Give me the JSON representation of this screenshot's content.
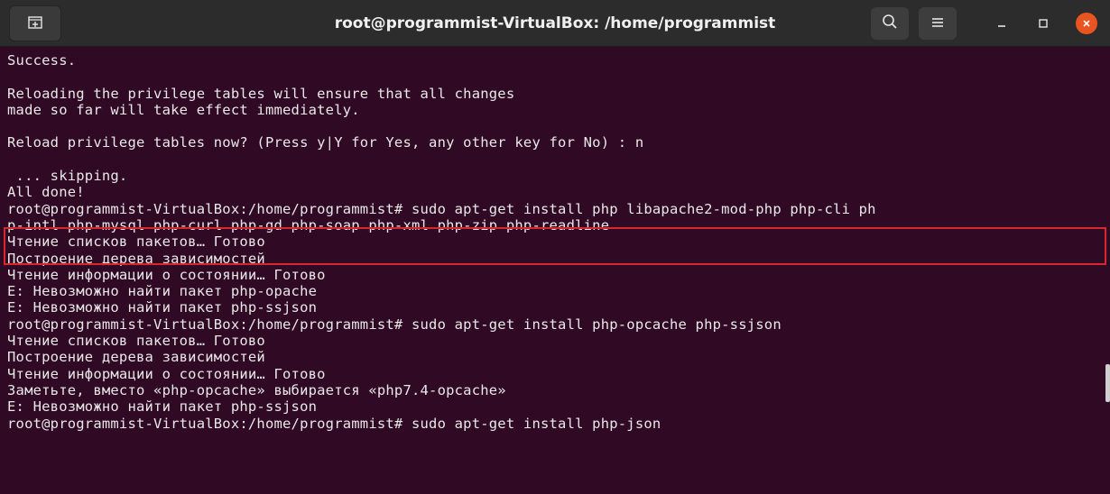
{
  "window": {
    "title": "root@programmist-VirtualBox: /home/programmist",
    "icons": {
      "new_tab": "new-tab-icon",
      "search": "search-icon",
      "menu": "hamburger-menu-icon",
      "minimize": "minimize-icon",
      "maximize": "maximize-icon",
      "close": "close-icon"
    },
    "colors": {
      "terminal_bg": "#300a24",
      "titlebar_bg": "#2c2c2c",
      "close_accent": "#e95420",
      "highlight_border": "#d7262c"
    }
  },
  "terminal": {
    "lines": [
      "Success.",
      "",
      "Reloading the privilege tables will ensure that all changes",
      "made so far will take effect immediately.",
      "",
      "Reload privilege tables now? (Press y|Y for Yes, any other key for No) : n",
      "",
      " ... skipping.",
      "All done!",
      "root@programmist-VirtualBox:/home/programmist# sudo apt-get install php libapache2-mod-php php-cli ph",
      "p-intl php-mysql php-curl php-gd php-soap php-xml php-zip php-readline",
      "Чтение списков пакетов… Готово",
      "Построение дерева зависимостей",
      "Чтение информации о состоянии… Готово",
      "E: Невозможно найти пакет php-opache",
      "E: Невозможно найти пакет php-ssjson",
      "root@programmist-VirtualBox:/home/programmist# sudo apt-get install php-opcache php-ssjson",
      "Чтение списков пакетов… Готово",
      "Построение дерева зависимостей",
      "Чтение информации о состоянии… Готово",
      "Заметьте, вместо «php-opcache» выбирается «php7.4-opcache»",
      "E: Невозможно найти пакет php-ssjson",
      "root@programmist-VirtualBox:/home/programmist# sudo apt-get install php-json"
    ]
  }
}
